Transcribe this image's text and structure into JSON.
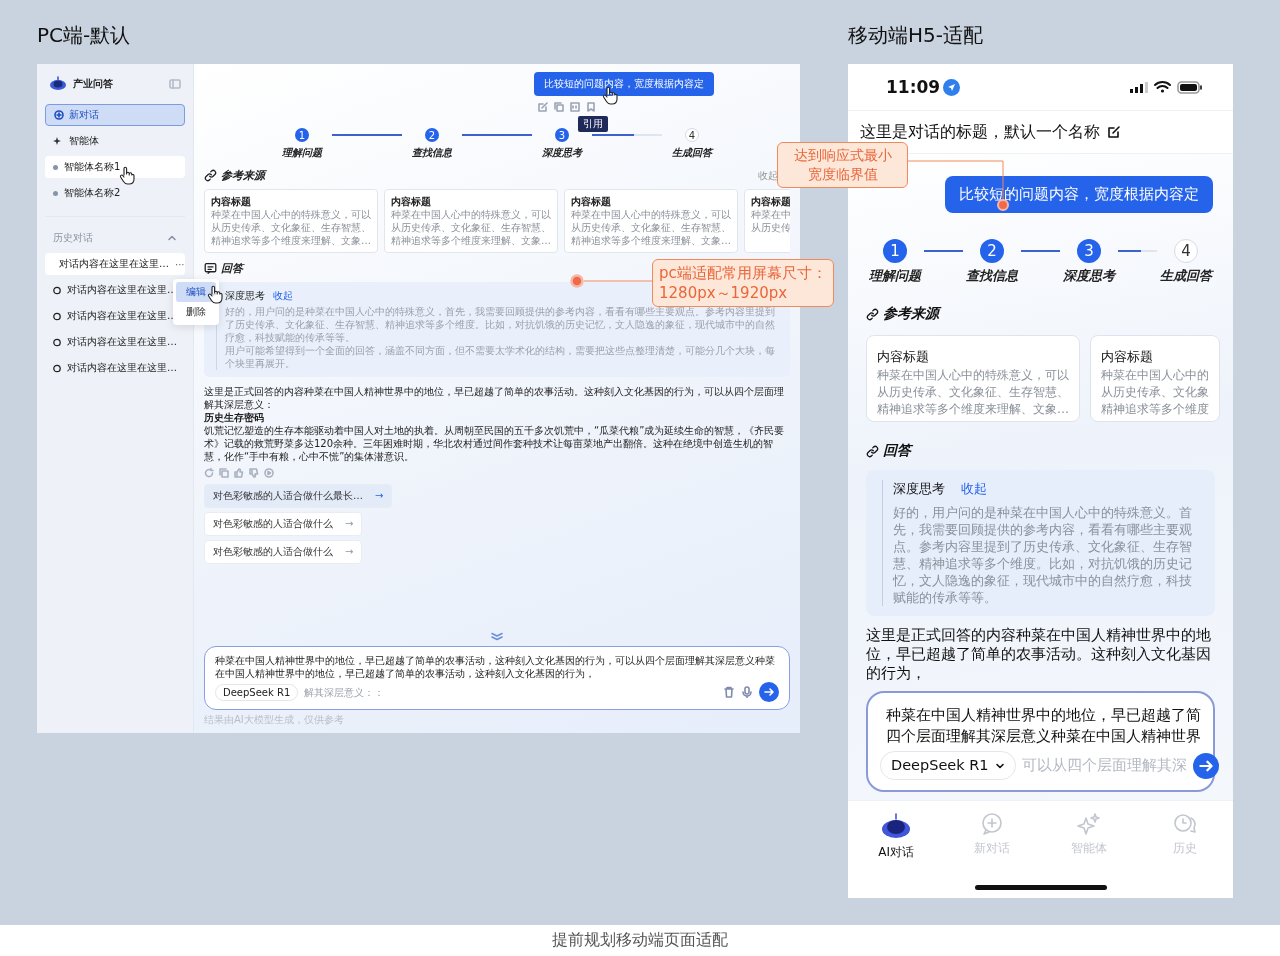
{
  "headings": {
    "pc": "PC端-默认",
    "mobile": "移动端H5-适配"
  },
  "pc": {
    "sidebar": {
      "app_name": "产业问答",
      "new_chat": {
        "label": "新对话",
        "selected": true
      },
      "agents_label": "智能体",
      "agents": [
        {
          "label": "智能体名称1",
          "highlighted": true
        },
        {
          "label": "智能体名称2",
          "highlighted": false
        }
      ],
      "history_label": "历史对话",
      "history": [
        {
          "label": "对话内容在这里在这里…",
          "highlighted": true,
          "more": "···"
        },
        {
          "label": "对话内容在这里在这里…",
          "highlighted": false
        },
        {
          "label": "对话内容在这里在这里…",
          "highlighted": false
        },
        {
          "label": "对话内容在这里在这里…",
          "highlighted": false
        },
        {
          "label": "对话内容在这里在这里…",
          "highlighted": false
        }
      ],
      "context_menu": [
        {
          "label": "编辑",
          "selected": true
        },
        {
          "label": "删除",
          "selected": false
        }
      ]
    },
    "bubble": "比较短的问题内容，宽度根据内容定",
    "tooltip": "引用",
    "steps": [
      {
        "number": "1",
        "label": "理解问题",
        "done": true
      },
      {
        "number": "2",
        "label": "查找信息",
        "done": true
      },
      {
        "number": "3",
        "label": "深度思考",
        "done": true
      },
      {
        "number": "4",
        "label": "生成回答",
        "done": false
      }
    ],
    "connectors": [
      {
        "level": 1
      },
      {
        "level": 1
      },
      {
        "level": 0.6
      }
    ],
    "sources": {
      "title": "参考来源",
      "collapse": "收起",
      "cards": [
        {
          "title": "内容标题",
          "lines": [
            "种菜在中国人心中的特殊意义，可以",
            "从历史传承、文化象征、生存智慧、",
            "精神追求等多个维度来理解、文象…"
          ]
        },
        {
          "title": "内容标题",
          "lines": [
            "种菜在中国人心中的特殊意义，可以",
            "从历史传承、文化象征、生存智慧、",
            "精神追求等多个维度来理解、文象…"
          ]
        },
        {
          "title": "内容标题",
          "lines": [
            "种菜在中国人心中的特殊意义，可以",
            "从历史传承、文化象征、生存智慧、",
            "精神追求等多个维度来理解、文象…"
          ]
        },
        {
          "title": "内容标题",
          "lines": [
            "种菜在中",
            "从历史传"
          ]
        }
      ]
    },
    "answer_title": "回答",
    "thinking": {
      "label": "深度思考",
      "toggle": "收起",
      "paragraphs": [
        "好的，用户问的是种菜在中国人心中的特殊意义，首先，我需要回顾提供的参考内容，看看有哪些主要观点。参考内容里提到了历史传承、文化象征、生存智慧、精神追求等多个维度。比如，对抗饥饿的历史记忆，文人隐逸的象征，现代城市中的自然疗愈，科技赋能的传承等等。",
        "用户可能希望得到一个全面的回答，涵盖不同方面，但不需要太学术化的结构，需要把这些点整理清楚，可能分几个大块，每个块里再展开。"
      ]
    },
    "answer": {
      "intro": "这里是正式回答的内容种菜在中国人精神世界中的地位，早已超越了简单的农事活动。这种刻入文化基因的行为，可以从四个层面理解其深层意义：",
      "heading": "历史生存密码",
      "body": "饥荒记忆塑造的生存本能驱动着中国人对土地的执着。从周朝至民国的五千多次饥荒中，“瓜菜代粮”成为延续生命的智慧，《齐民要术》记载的救荒野菜多达120余种。三年困难时期，华北农村通过间作套种技术让每亩菜地产出翻倍。这种在绝境中创造生机的智慧，化作“手中有粮，心中不慌”的集体潜意识。"
    },
    "suggestions": [
      {
        "label": "对色彩敏感的人适合做什么最长…",
        "arrow": "→",
        "selected": true
      },
      {
        "label": "对色彩敏感的人适合做什么",
        "arrow": "→",
        "selected": false
      },
      {
        "label": "对色彩敏感的人适合做什么",
        "arrow": "→",
        "selected": false
      }
    ],
    "input": {
      "text": "种菜在中国人精神世界中的地位，早已超越了简单的农事活动，这种刻入文化基因的行为，可以从四个层面理解其深层意义种菜在中国人精神世界中的地位，早已超越了简单的农事活动，这种刻入文化基因的行为，",
      "model": "DeepSeek R1",
      "faded": "解其深层意义：："
    },
    "hint": "结果由AI大模型生成，仅供参考"
  },
  "mobile": {
    "time": "11:09",
    "title": "这里是对话的标题，默认一个名称",
    "bubble": "比较短的问题内容，宽度根据内容定",
    "steps": [
      {
        "number": "1",
        "label": "理解问题",
        "done": true
      },
      {
        "number": "2",
        "label": "查找信息",
        "done": true
      },
      {
        "number": "3",
        "label": "深度思考",
        "done": true
      },
      {
        "number": "4",
        "label": "生成回答",
        "done": false
      }
    ],
    "connectors": [
      {
        "level": 1
      },
      {
        "level": 1
      },
      {
        "level": 0.6
      }
    ],
    "sources": {
      "title": "参考来源",
      "cards": [
        {
          "title": "内容标题",
          "lines": [
            "种菜在中国人心中的特殊意义，可以",
            "从历史传承、文化象征、生存智慧、",
            "精神追求等多个维度来理解、文象…"
          ]
        },
        {
          "title": "内容标题",
          "lines": [
            "种菜在中国人心中的",
            "从历史传承、文化象",
            "精神追求等多个维度"
          ]
        }
      ]
    },
    "answer_title": "回答",
    "thinking": {
      "label": "深度思考",
      "toggle": "收起",
      "text": "好的，用户问的是种菜在中国人心中的特殊意义。首先，我需要回顾提供的参考内容，看看有哪些主要观点。参考内容里提到了历史传承、文化象征、生存智慧、精神追求等多个维度。比如，对抗饥饿的历史记忆，文人隐逸的象征，现代城市中的自然疗愈，科技赋能的传承等等。"
    },
    "answer": "这里是正式回答的内容种菜在中国人精神世界中的地位，早已超越了简单的农事活动。这种刻入文化基因的行为，",
    "input": {
      "lines": [
        "种菜在中国人精神世界中的地位，早已超越了简",
        "四个层面理解其深层意义种菜在中国人精神世界"
      ],
      "model": "DeepSeek R1",
      "faded": "可以从四个层面理解其深"
    },
    "tabs": [
      {
        "label": "AI对话",
        "selected": true
      },
      {
        "label": "新对话",
        "selected": false
      },
      {
        "label": "智能体",
        "selected": false
      },
      {
        "label": "历史",
        "selected": false
      }
    ]
  },
  "annotations": [
    {
      "lines": [
        "达到响应式最小",
        "宽度临界值"
      ]
    },
    {
      "lines": [
        "pc端适配常用屏幕尺寸：",
        "1280px～1920px"
      ]
    }
  ],
  "caption": "提前规划移动端页面适配"
}
